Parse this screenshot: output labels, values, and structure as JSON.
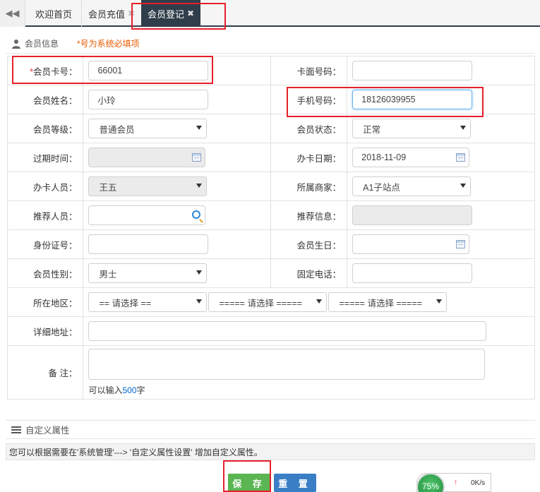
{
  "tabs": [
    {
      "label": "欢迎首页",
      "closable": false
    },
    {
      "label": "会员充值",
      "closable": true
    },
    {
      "label": "会员登记",
      "closable": true,
      "active": true
    }
  ],
  "section": {
    "title": "会员信息",
    "required_tip": "*号为系统必填项"
  },
  "form": {
    "card_no": {
      "label": "会员卡号：",
      "value": "66001"
    },
    "face_no": {
      "label": "卡面号码：",
      "value": ""
    },
    "name": {
      "label": "会员姓名：",
      "value": "小玲"
    },
    "phone": {
      "label": "手机号码：",
      "value": "18126039955"
    },
    "level": {
      "label": "会员等级：",
      "value": "普通会员"
    },
    "status": {
      "label": "会员状态：",
      "value": "正常"
    },
    "expire": {
      "label": "过期时间：",
      "value": ""
    },
    "open_date": {
      "label": "办卡日期：",
      "value": "2018-11-09"
    },
    "operator": {
      "label": "办卡人员：",
      "value": "王五"
    },
    "merchant": {
      "label": "所属商家：",
      "value": "A1子站点"
    },
    "referrer": {
      "label": "推荐人员：",
      "value": ""
    },
    "ref_info": {
      "label": "推荐信息：",
      "value": ""
    },
    "id_no": {
      "label": "身份证号：",
      "value": ""
    },
    "birthday": {
      "label": "会员生日：",
      "value": ""
    },
    "gender": {
      "label": "会员性别：",
      "value": "男士"
    },
    "tel": {
      "label": "固定电话：",
      "value": ""
    },
    "region": {
      "label": "所在地区：",
      "province": "== 请选择 ==",
      "city": "===== 请选择 =====",
      "district": "===== 请选择 ====="
    },
    "address": {
      "label": "详细地址：",
      "value": ""
    },
    "remark": {
      "label": "备 注：",
      "hint_prefix": "可以输入",
      "hint_num": "500",
      "hint_suffix": "字"
    }
  },
  "custom": {
    "title": "自定义属性",
    "tip": "您可以根据需要在'系统管理'---> '自定义属性设置' 增加自定义属性。"
  },
  "buttons": {
    "save": "保 存",
    "reset": "重 置"
  },
  "speed": {
    "percent": "75%",
    "rate": "0K/s"
  }
}
